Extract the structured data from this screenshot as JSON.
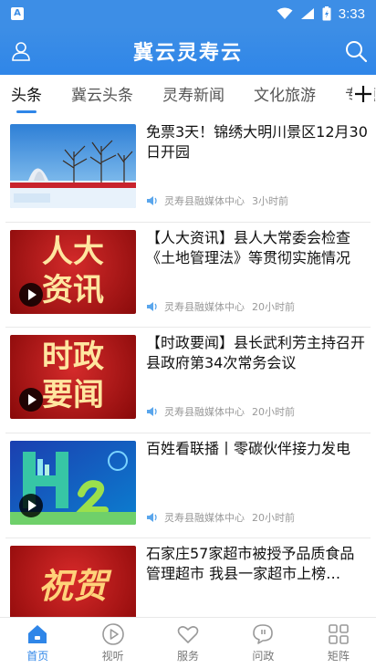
{
  "status_bar": {
    "time": "3:33"
  },
  "header": {
    "title": "冀云灵寿云"
  },
  "tabs": [
    {
      "label": "头条",
      "active": true
    },
    {
      "label": "冀云头条",
      "active": false
    },
    {
      "label": "灵寿新闻",
      "active": false
    },
    {
      "label": "文化旅游",
      "active": false
    },
    {
      "label": "专题",
      "active": false
    }
  ],
  "articles": [
    {
      "title": "免票3天！锦绣大明川景区12月30日开园",
      "source": "灵寿县融媒体中心",
      "time": "3小时前",
      "thumb_text": "",
      "has_video": false
    },
    {
      "title": "【人大资讯】县人大常委会检查《土地管理法》等贯彻实施情况",
      "source": "灵寿县融媒体中心",
      "time": "20小时前",
      "thumb_text": "人大\n资讯",
      "thumb_line1": "人大",
      "thumb_line2": "资讯",
      "has_video": true
    },
    {
      "title": "【时政要闻】县长武利芳主持召开县政府第34次常务会议",
      "source": "灵寿县融媒体中心",
      "time": "20小时前",
      "thumb_line1": "时政",
      "thumb_line2": "要闻",
      "has_video": true
    },
    {
      "title": "百姓看联播丨零碳伙伴接力发电",
      "source": "灵寿县融媒体中心",
      "time": "20小时前",
      "has_video": true
    },
    {
      "title": "石家庄57家超市被授予品质食品管理超市 我县一家超市上榜…",
      "source": "",
      "time": "",
      "thumb_line1": "祝贺",
      "has_video": false
    }
  ],
  "bottom_nav": [
    {
      "label": "首页",
      "icon": "home-icon",
      "active": true
    },
    {
      "label": "视听",
      "icon": "play-circle-icon",
      "active": false
    },
    {
      "label": "服务",
      "icon": "heart-icon",
      "active": false
    },
    {
      "label": "问政",
      "icon": "chat-bubble-icon",
      "active": false
    },
    {
      "label": "矩阵",
      "icon": "grid-icon",
      "active": false
    }
  ],
  "colors": {
    "brand": "#2f86e8",
    "status_bar": "#3d8ee6"
  }
}
